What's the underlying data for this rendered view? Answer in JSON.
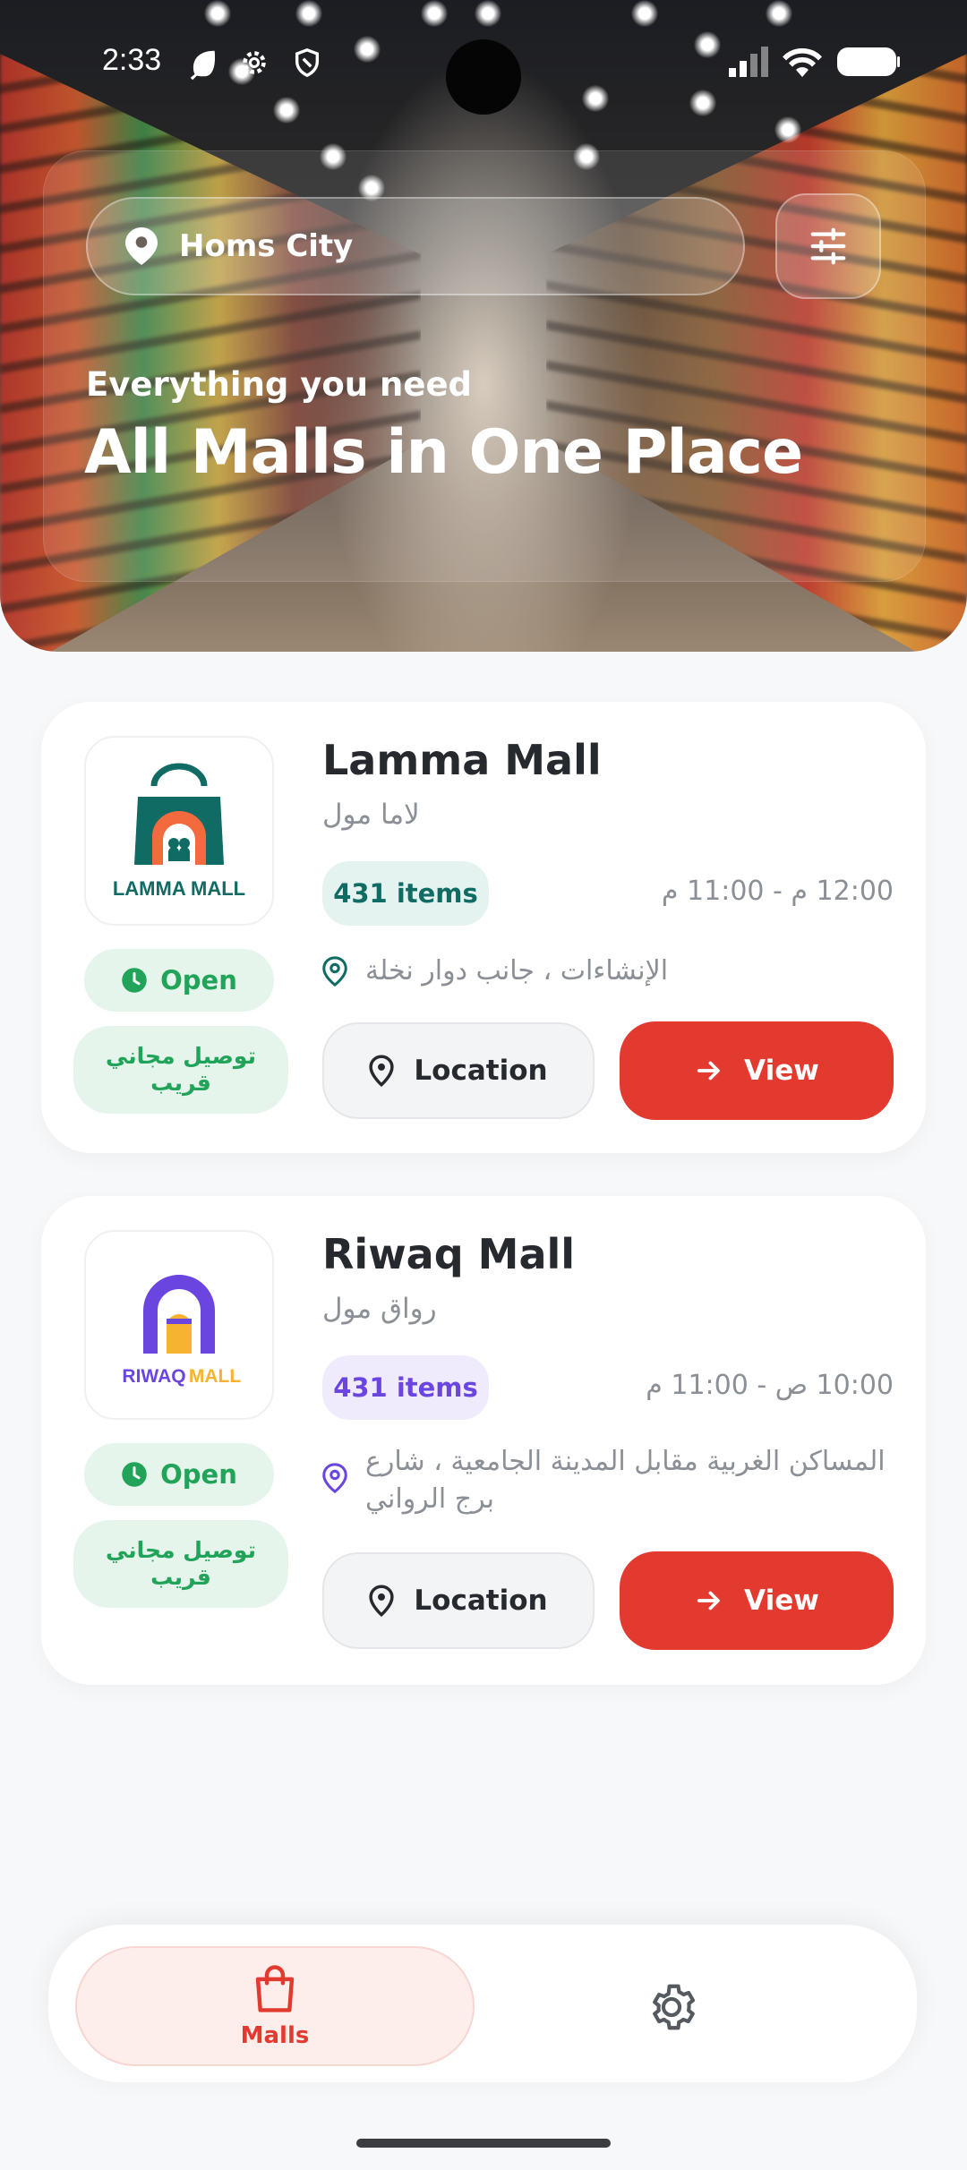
{
  "status_bar": {
    "time": "2:33"
  },
  "header": {
    "location_label": "Homs City",
    "subtitle": "Everything you need",
    "title": "All Malls in One Place"
  },
  "malls": [
    {
      "name": "Lamma Mall",
      "name_ar": "لاما مول",
      "logo_text": "LAMMA MALL",
      "items": "431 items",
      "hours": "12:00 م - 11:00 م",
      "address": "الإنشاءات ، جانب دوار نخلة",
      "status": "Open",
      "delivery": "توصيل مجاني قريب",
      "location_label": "Location",
      "view_label": "View",
      "accent_color": "#0f6b63",
      "items_badge_bg": "#e4f3ef"
    },
    {
      "name": "Riwaq Mall",
      "name_ar": "رواق مول",
      "logo_text_1": "RIWAQ",
      "logo_text_2": "MALL",
      "items": "431 items",
      "hours": "10:00 ص - 11:00 م",
      "address": "المساكن الغربية مقابل المدينة الجامعية ، شارع برج الرواني",
      "status": "Open",
      "delivery": "توصيل مجاني قريب",
      "location_label": "Location",
      "view_label": "View",
      "accent_color": "#6a45e0",
      "items_badge_bg": "#efebfd"
    }
  ],
  "bottom_nav": {
    "items": [
      {
        "label": "Malls",
        "icon": "shopping-bag-icon",
        "active": true
      },
      {
        "label": "",
        "icon": "gear-icon",
        "active": false
      }
    ]
  },
  "colors": {
    "primary": "#e33a30",
    "open_green": "#21a35a",
    "background": "#f7f8fa"
  }
}
